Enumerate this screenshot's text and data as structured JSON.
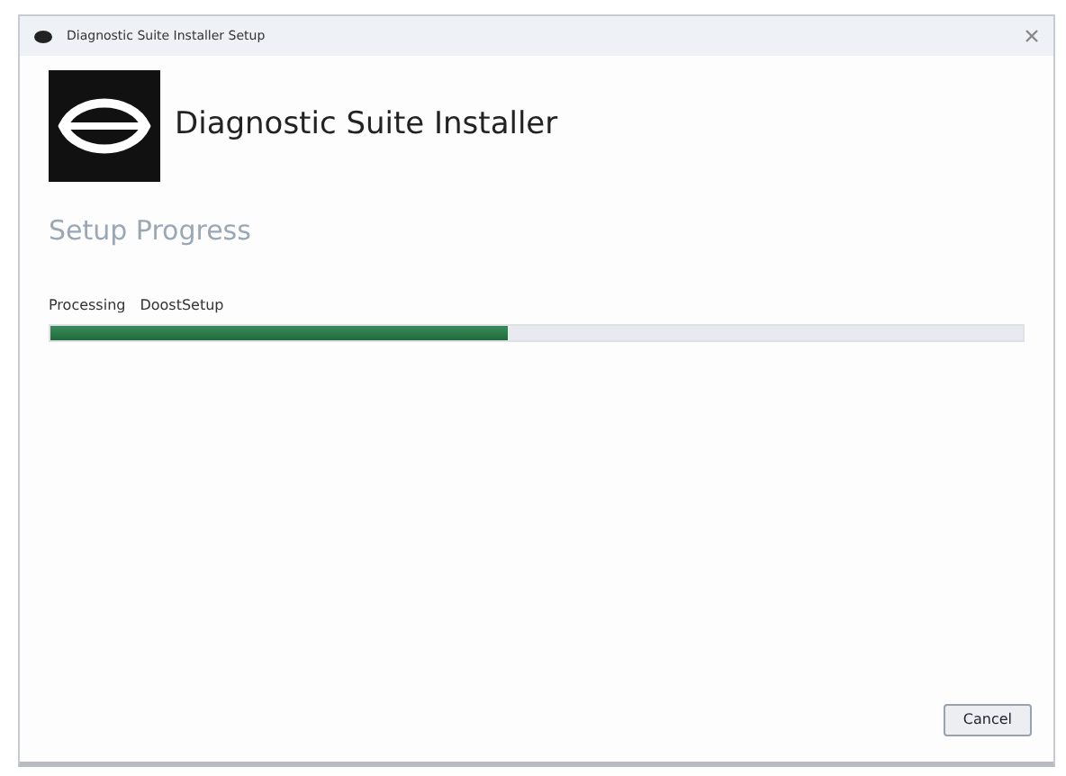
{
  "window": {
    "title": "Diagnostic Suite Installer Setup"
  },
  "header": {
    "title": "Diagnostic Suite Installer"
  },
  "section_title": "Setup Progress",
  "status": {
    "label": "Processing",
    "value": "DoostSetup"
  },
  "progress": {
    "level": 0.47
  },
  "buttons": [
    {
      "label": "Cancel",
      "kind": "cancel"
    }
  ]
}
